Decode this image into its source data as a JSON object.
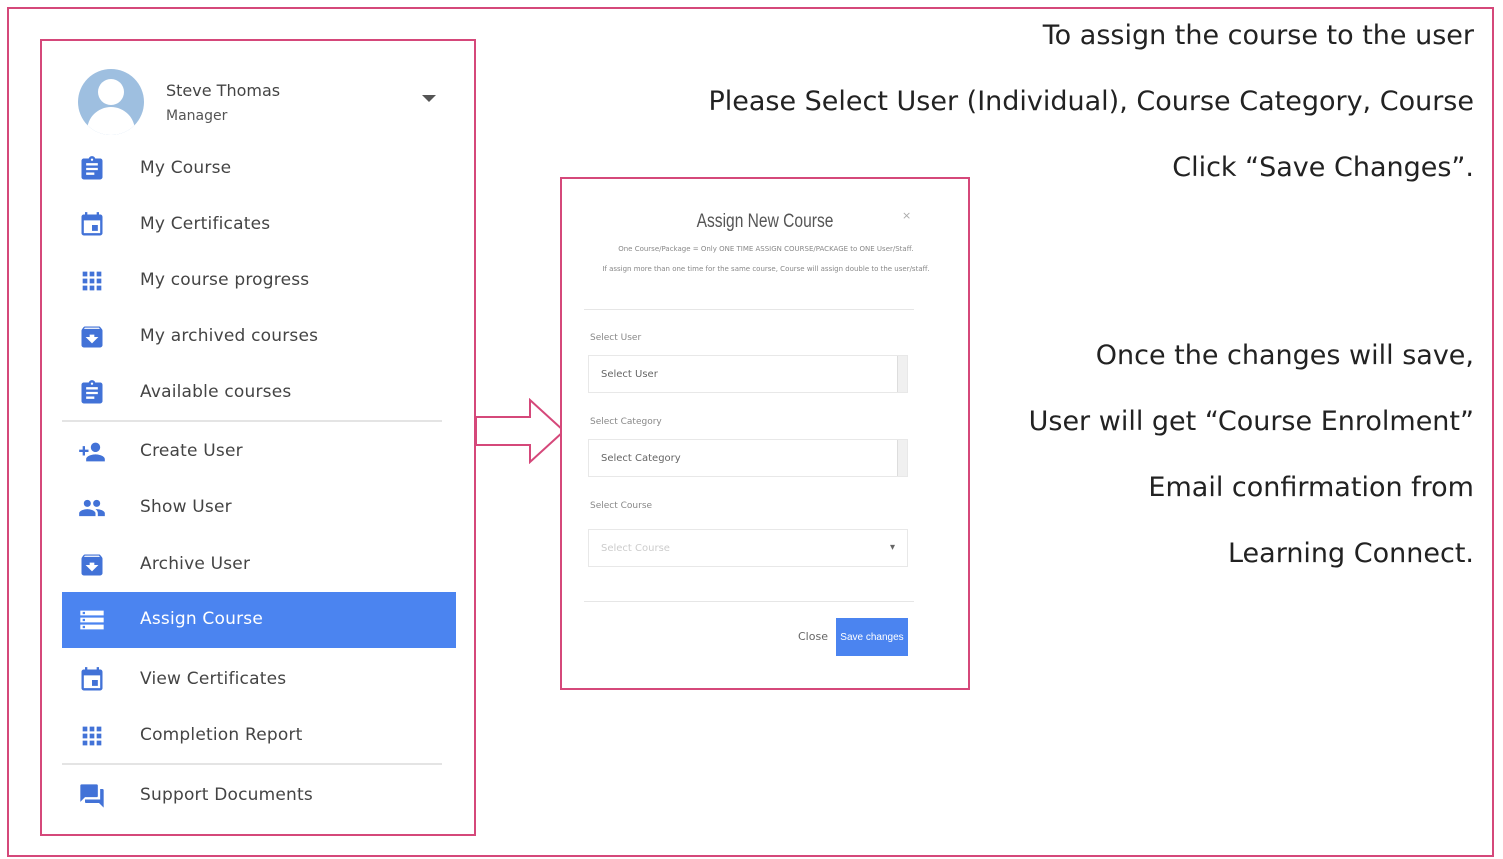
{
  "profile": {
    "name": "Steve Thomas",
    "role": "Manager"
  },
  "nav_items": [
    {
      "label": "My Course",
      "icon": "clipboard-icon"
    },
    {
      "label": "My Certificates",
      "icon": "calendar-icon"
    },
    {
      "label": "My course progress",
      "icon": "grid-icon"
    },
    {
      "label": "My archived courses",
      "icon": "archive-icon"
    },
    {
      "label": "Available courses",
      "icon": "clipboard-icon"
    },
    {
      "label": "Create User",
      "icon": "person-add-icon"
    },
    {
      "label": "Show User",
      "icon": "people-icon"
    },
    {
      "label": "Archive User",
      "icon": "archive-icon"
    },
    {
      "label": "Assign Course",
      "icon": "storage-icon",
      "active": true
    },
    {
      "label": "View Certificates",
      "icon": "calendar-icon"
    },
    {
      "label": "Completion Report",
      "icon": "grid-icon"
    },
    {
      "label": "Support Documents",
      "icon": "chat-icon"
    }
  ],
  "dialog": {
    "title": "Assign New Course",
    "close_symbol": "×",
    "note_line1": "One Course/Package = Only ONE TIME ASSIGN COURSE/PACKAGE to ONE User/Staff.",
    "note_line2": "If assign more than one time for the same course, Course will assign double to the user/staff.",
    "select_user_label": "Select User",
    "select_user_value": "Select User",
    "select_category_label": "Select Category",
    "select_category_value": "Select Category",
    "select_course_label": "Select Course",
    "select_course_value": "Select Course",
    "close_button": "Close",
    "save_button": "Save changes"
  },
  "instructions": {
    "line1": "To assign the course to the user",
    "line2": "Please Select User (Individual), Course Category, Course",
    "line3": "Click “Save Changes”.",
    "line4": "Once the changes will save,",
    "line5": "User will get “Course Enrolment”",
    "line6": "Email confirmation from",
    "line7": "Learning Connect."
  },
  "colors": {
    "accent": "#4b84f0",
    "icon": "#4272d7",
    "frame": "#d5487a"
  }
}
